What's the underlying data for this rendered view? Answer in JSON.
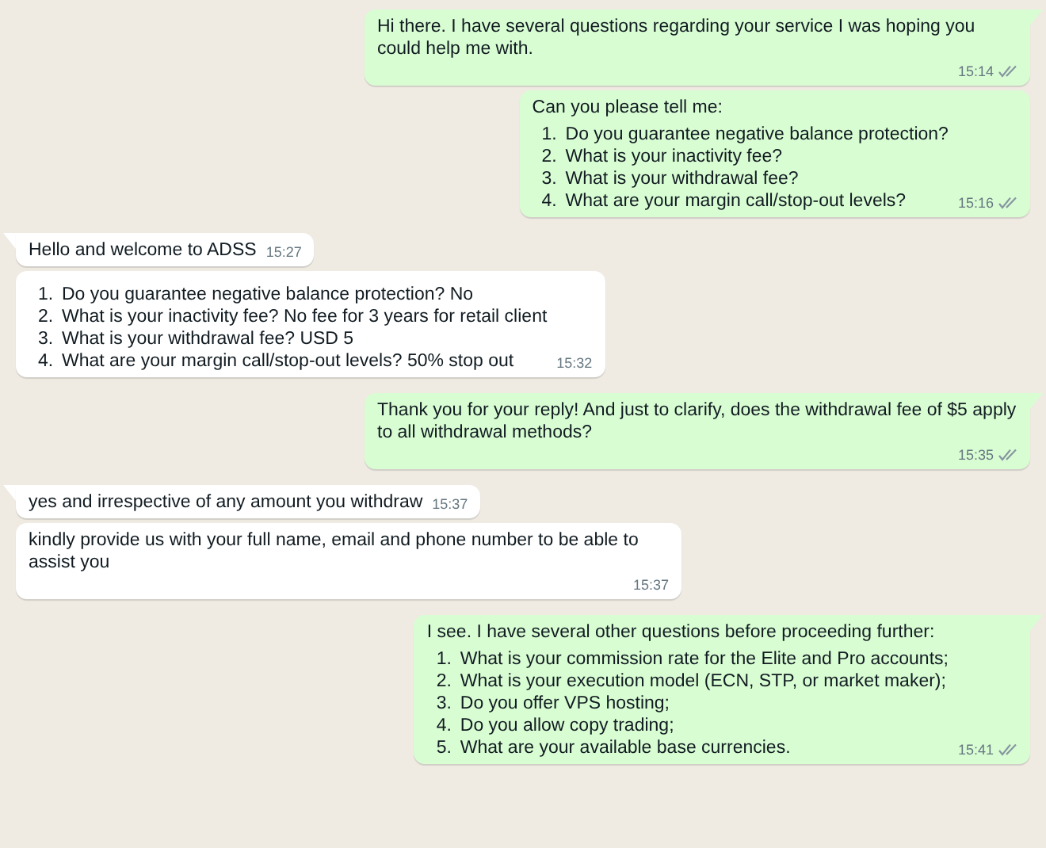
{
  "messages": [
    {
      "kind": "outgoing",
      "text": "Hi there. I have several questions regarding your service I was hoping you could help me with.",
      "time": "15:14",
      "read": false
    },
    {
      "kind": "outgoing",
      "text": "Can you please tell me:",
      "items": [
        {
          "number": "1.",
          "text": "Do you guarantee negative balance protection?"
        },
        {
          "number": "2.",
          "text": "What is your inactivity fee?"
        },
        {
          "number": "3.",
          "text": "What is your withdrawal fee?"
        },
        {
          "number": "4.",
          "text": "What are your margin call/stop-out levels?"
        }
      ],
      "time": "15:16",
      "read": false
    },
    {
      "kind": "incoming",
      "text": "Hello and welcome to ADSS",
      "time": "15:27"
    },
    {
      "kind": "incoming",
      "items": [
        {
          "number": "1.",
          "text": "Do you guarantee negative balance protection? No"
        },
        {
          "number": "2.",
          "text": "What is your inactivity fee? No fee for 3 years for retail client"
        },
        {
          "number": "3.",
          "text": "What is your withdrawal fee? USD 5"
        },
        {
          "number": "4.",
          "text": "What are your margin call/stop-out levels? 50% stop out"
        }
      ],
      "time": "15:32"
    },
    {
      "kind": "outgoing",
      "text": "Thank you for your reply! And just to clarify, does the withdrawal fee of $5 apply to all withdrawal methods?",
      "time": "15:35",
      "read": false
    },
    {
      "kind": "incoming",
      "text": "yes and irrespective of any amount you withdraw",
      "time": "15:37"
    },
    {
      "kind": "incoming",
      "text": "kindly provide us with your full name, email and phone number to be able to assist you",
      "time": "15:37"
    },
    {
      "kind": "outgoing",
      "text": "I see. I have several other questions before proceeding further:",
      "items": [
        {
          "number": "1.",
          "text": "What is your commission rate for the Elite and Pro accounts;"
        },
        {
          "number": "2.",
          "text": "What is your execution model (ECN, STP, or market maker);"
        },
        {
          "number": "3.",
          "text": "Do you offer VPS hosting;"
        },
        {
          "number": "4.",
          "text": "Do you allow copy trading;"
        },
        {
          "number": "5.",
          "text": "What are your available base currencies."
        }
      ],
      "time": "15:41",
      "read": false
    }
  ]
}
